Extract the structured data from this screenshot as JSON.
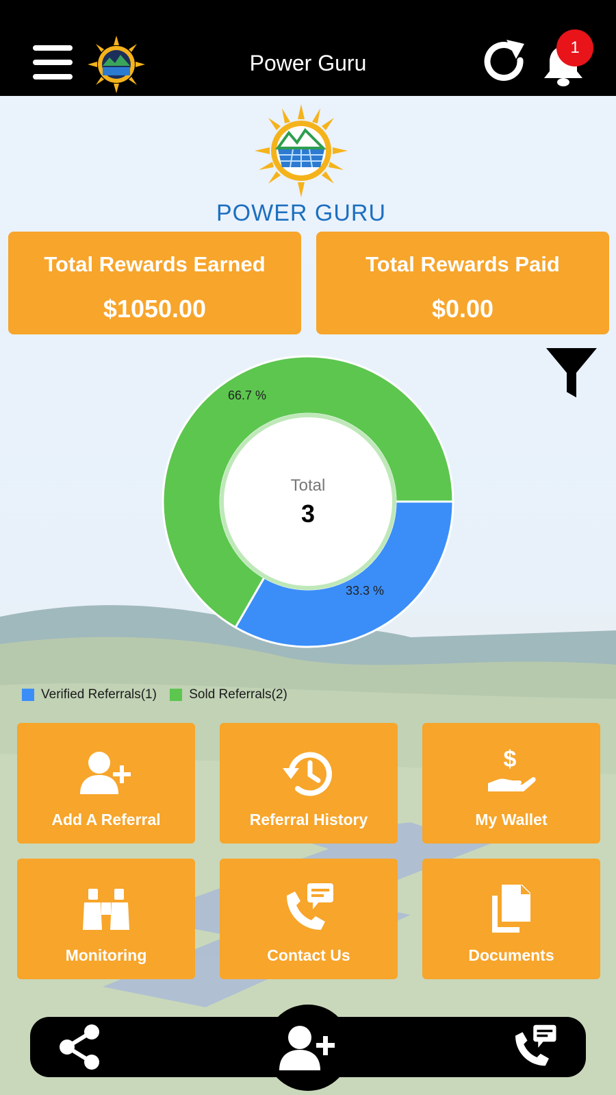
{
  "header": {
    "title": "Power Guru",
    "notification_count": "1",
    "icons": [
      "menu-icon",
      "app-logo",
      "refresh-icon",
      "bell-icon"
    ]
  },
  "brand": {
    "name": "POWER GURU"
  },
  "rewards": {
    "earned_label": "Total Rewards Earned",
    "earned_value": "$1050.00",
    "paid_label": "Total Rewards Paid",
    "paid_value": "$0.00"
  },
  "chart_data": {
    "type": "pie",
    "donut": true,
    "center_label": "Total",
    "center_value": "3",
    "slices": [
      {
        "name": "Verified Referrals(1)",
        "value": 1,
        "percent_label": "33.3 %",
        "color": "#3b8ef8"
      },
      {
        "name": "Sold Referrals(2)",
        "value": 2,
        "percent_label": "66.7 %",
        "color": "#5cc64f"
      }
    ],
    "legend_placement": "bottom-left"
  },
  "tiles": [
    {
      "label": "Add A Referral",
      "icon": "add-user-icon"
    },
    {
      "label": "Referral History",
      "icon": "history-icon"
    },
    {
      "label": "My Wallet",
      "icon": "wallet-hand-dollar-icon"
    },
    {
      "label": "Monitoring",
      "icon": "binoculars-icon"
    },
    {
      "label": "Contact Us",
      "icon": "phone-message-icon"
    },
    {
      "label": "Documents",
      "icon": "documents-icon"
    }
  ],
  "bottom_nav": {
    "icons": [
      "share-icon",
      "add-user-icon",
      "phone-message-icon"
    ]
  },
  "colors": {
    "header_bg": "#000000",
    "accent_orange": "#f7a52b",
    "brand_blue": "#1c6fbf",
    "verified_blue": "#3b8ef8",
    "sold_green": "#5cc64f",
    "badge_red": "#e8141a"
  }
}
